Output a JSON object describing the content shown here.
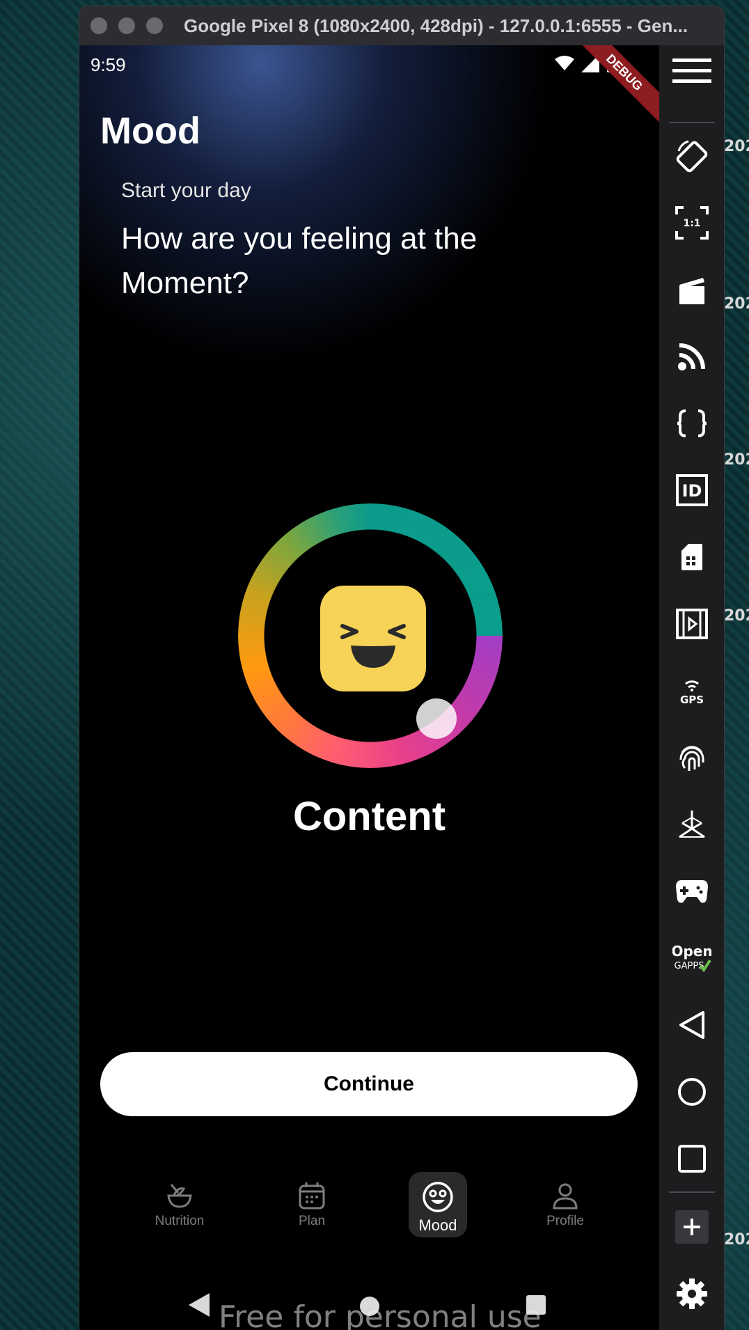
{
  "desktop": {
    "bg_labels": [
      "202",
      "202",
      "202",
      "202",
      "202"
    ]
  },
  "window": {
    "title": "Google Pixel 8 (1080x2400, 428dpi) - 127.0.0.1:6555 - Gen..."
  },
  "statusbar": {
    "time": "9:59",
    "debug_label": "DEBUG"
  },
  "page": {
    "title": "Mood",
    "subtitle": "Start your day",
    "question": "How are you feeling at the Moment?"
  },
  "mood": {
    "current_label": "Content",
    "ring_colors": [
      "#0c9a8c",
      "#a33ec4",
      "#e8408a",
      "#ff9a10",
      "#7aa640"
    ],
    "face_color": "#f6d257"
  },
  "actions": {
    "continue_label": "Continue"
  },
  "bottom_nav": {
    "items": [
      {
        "label": "Nutrition",
        "icon": "bowl-icon",
        "active": false
      },
      {
        "label": "Plan",
        "icon": "calendar-icon",
        "active": false
      },
      {
        "label": "Mood",
        "icon": "smiley-icon",
        "active": true
      },
      {
        "label": "Profile",
        "icon": "person-icon",
        "active": false
      }
    ]
  },
  "system_nav": {
    "watermark": "Free for personal use"
  },
  "toolbar": {
    "items": [
      "menu-icon",
      "rotate-icon",
      "fit-icon",
      "clapper-icon",
      "rss-icon",
      "braces-icon",
      "id-icon",
      "sim-icon",
      "film-icon",
      "gps-icon",
      "fingerprint-icon",
      "axis-icon",
      "gamepad-icon",
      "opengapps-icon",
      "back-icon",
      "home-icon",
      "recents-icon",
      "add-icon",
      "settings-icon"
    ],
    "gps_text": "GPS",
    "id_text": "ID",
    "fit_text": "1:1",
    "opengapps_line1": "Open",
    "opengapps_line2": "GAPPS"
  }
}
